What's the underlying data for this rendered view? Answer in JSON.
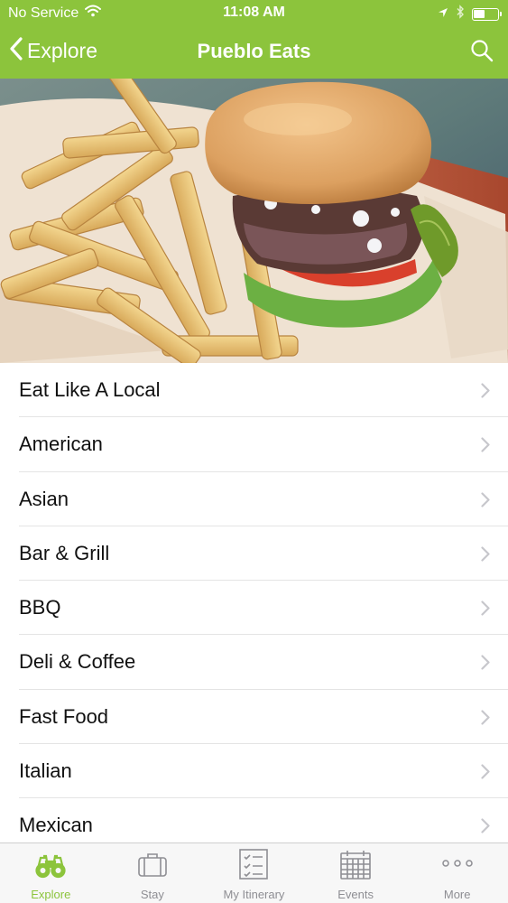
{
  "colors": {
    "brand_green": "#8cc43c",
    "tab_inactive": "#8e8e93",
    "text": "#111111",
    "separator": "#e4e4e4"
  },
  "status_bar": {
    "carrier": "No Service",
    "time": "11:08 AM",
    "icons": [
      "wifi-icon",
      "location-arrow-icon",
      "bluetooth-icon",
      "battery-icon"
    ]
  },
  "nav": {
    "back_label": "Explore",
    "title": "Pueblo Eats",
    "search_icon": "search-icon"
  },
  "hero": {
    "image": "burger-and-fries-photo"
  },
  "categories": [
    {
      "label": "Eat Like A Local"
    },
    {
      "label": "American"
    },
    {
      "label": "Asian"
    },
    {
      "label": "Bar & Grill"
    },
    {
      "label": "BBQ"
    },
    {
      "label": "Deli & Coffee"
    },
    {
      "label": "Fast Food"
    },
    {
      "label": "Italian"
    },
    {
      "label": "Mexican"
    }
  ],
  "tabs": [
    {
      "label": "Explore",
      "icon": "binoculars-icon",
      "active": true
    },
    {
      "label": "Stay",
      "icon": "suitcase-icon",
      "active": false
    },
    {
      "label": "My Itinerary",
      "icon": "checklist-icon",
      "active": false
    },
    {
      "label": "Events",
      "icon": "calendar-icon",
      "active": false
    },
    {
      "label": "More",
      "icon": "more-dots-icon",
      "active": false
    }
  ]
}
